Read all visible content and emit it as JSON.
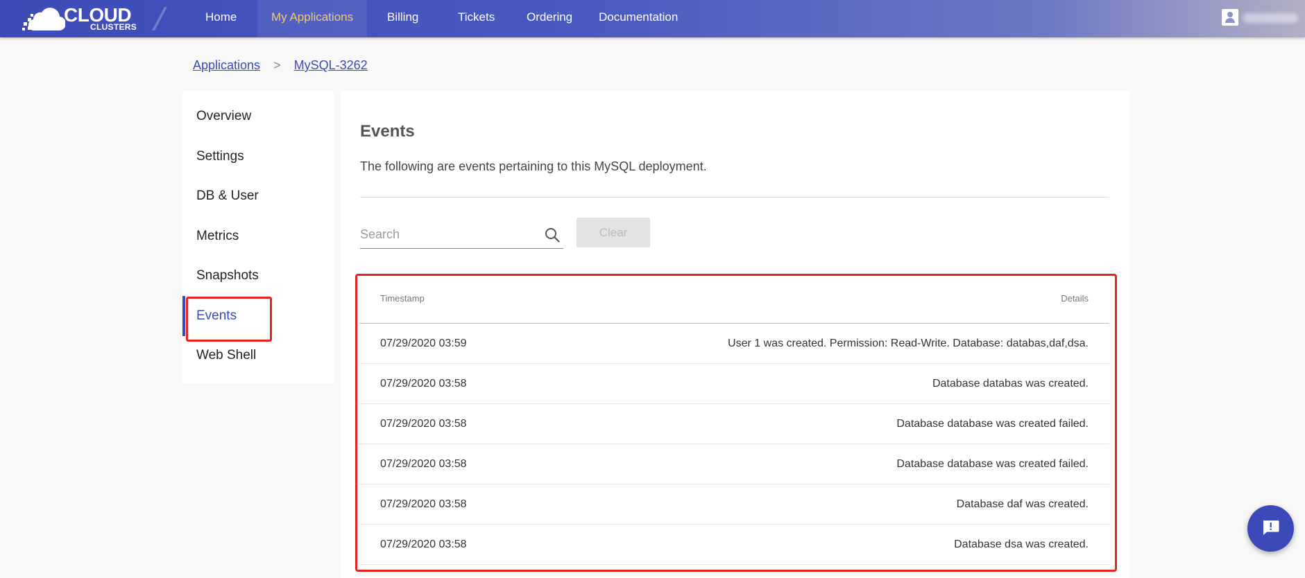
{
  "brand": {
    "line1": "CLOUD",
    "line2": "CLUSTERS"
  },
  "nav": {
    "items": [
      {
        "label": "Home",
        "active": false
      },
      {
        "label": "My Applications",
        "active": true
      },
      {
        "label": "Billing",
        "active": false
      },
      {
        "label": "Tickets",
        "active": false
      },
      {
        "label": "Ordering",
        "active": false
      },
      {
        "label": "Documentation",
        "active": false
      }
    ]
  },
  "breadcrumb": {
    "parent": "Applications",
    "separator": ">",
    "current": "MySQL-3262"
  },
  "sidebar": {
    "items": [
      {
        "label": "Overview",
        "active": false
      },
      {
        "label": "Settings",
        "active": false
      },
      {
        "label": "DB & User",
        "active": false
      },
      {
        "label": "Metrics",
        "active": false
      },
      {
        "label": "Snapshots",
        "active": false
      },
      {
        "label": "Events",
        "active": true
      },
      {
        "label": "Web Shell",
        "active": false
      }
    ]
  },
  "main": {
    "title": "Events",
    "description": "The following are events pertaining to this MySQL deployment.",
    "search": {
      "placeholder": "Search",
      "value": ""
    },
    "clear_label": "Clear"
  },
  "table": {
    "headers": {
      "timestamp": "Timestamp",
      "details": "Details"
    },
    "rows": [
      {
        "timestamp": "07/29/2020 03:59",
        "details": "User 1 was created. Permission: Read-Write. Database: databas,daf,dsa."
      },
      {
        "timestamp": "07/29/2020 03:58",
        "details": "Database databas was created."
      },
      {
        "timestamp": "07/29/2020 03:58",
        "details": "Database database was created failed."
      },
      {
        "timestamp": "07/29/2020 03:58",
        "details": "Database database was created failed."
      },
      {
        "timestamp": "07/29/2020 03:58",
        "details": "Database daf was created."
      },
      {
        "timestamp": "07/29/2020 03:58",
        "details": "Database dsa was created."
      }
    ]
  },
  "icons": {
    "search": "search-icon",
    "user": "user-icon",
    "feedback": "feedback-icon"
  },
  "colors": {
    "accent": "#3b4ab8",
    "nav_active": "#f4c96a",
    "highlight": "#e52420"
  }
}
